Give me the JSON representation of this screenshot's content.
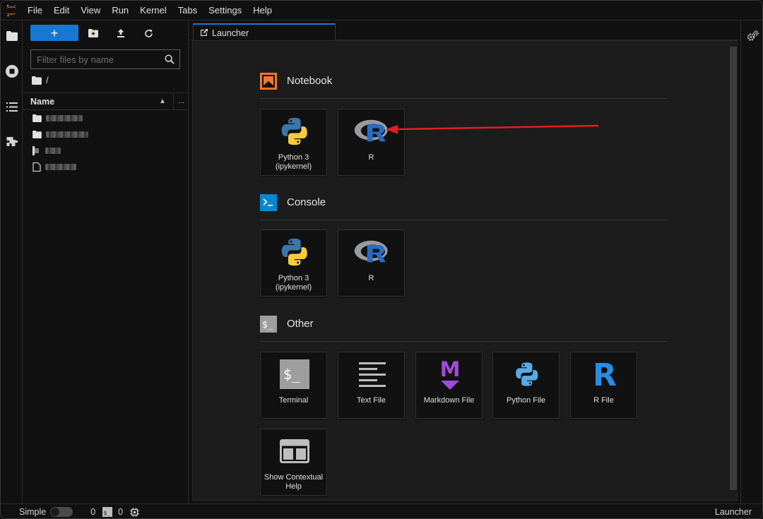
{
  "menu": [
    "File",
    "Edit",
    "View",
    "Run",
    "Kernel",
    "Tabs",
    "Settings",
    "Help"
  ],
  "filebrowser": {
    "new_label": "+",
    "filter_placeholder": "Filter files by name",
    "breadcrumb": "/",
    "column_name": "Name",
    "more_label": "...",
    "files": [
      {
        "icon": "folder-icon"
      },
      {
        "icon": "folder-icon"
      },
      {
        "icon": "notebook-file-icon"
      },
      {
        "icon": "text-file-icon"
      }
    ]
  },
  "tab": {
    "label": "Launcher"
  },
  "launcher": {
    "sections": {
      "notebook": {
        "title": "Notebook",
        "items": [
          {
            "label": "Python 3\n(ipykernel)",
            "icon": "python-logo-icon"
          },
          {
            "label": "R",
            "icon": "r-logo-icon"
          }
        ]
      },
      "console": {
        "title": "Console",
        "items": [
          {
            "label": "Python 3\n(ipykernel)",
            "icon": "python-logo-icon"
          },
          {
            "label": "R",
            "icon": "r-logo-icon"
          }
        ]
      },
      "other": {
        "title": "Other",
        "items": [
          {
            "label": "Terminal",
            "icon": "terminal-icon"
          },
          {
            "label": "Text File",
            "icon": "text-file-icon"
          },
          {
            "label": "Markdown File",
            "icon": "markdown-icon"
          },
          {
            "label": "Python File",
            "icon": "python-file-icon"
          },
          {
            "label": "R File",
            "icon": "r-file-icon"
          },
          {
            "label": "Show Contextual\nHelp",
            "icon": "contextual-help-icon"
          }
        ]
      }
    }
  },
  "statusbar": {
    "mode_label": "Simple",
    "terminals_count": "0",
    "kernels_count": "0",
    "right_label": "Launcher"
  },
  "colors": {
    "accent": "#1976d2",
    "annotation_arrow": "#e02020",
    "notebook_icon": "#f37726",
    "console_icon": "#0288d1",
    "markdown": "#a44ad8",
    "r_blue": "#276dc3"
  }
}
